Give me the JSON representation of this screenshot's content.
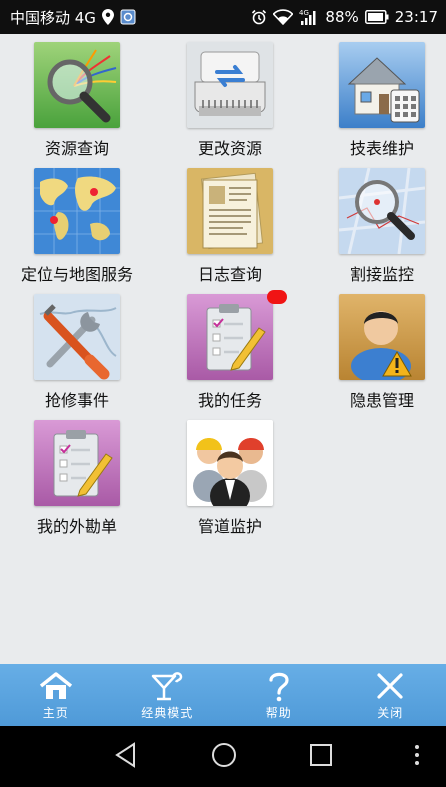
{
  "status_bar": {
    "carrier": "中国移动 4G",
    "battery": "88%",
    "time": "23:17"
  },
  "grid": {
    "tiles": [
      {
        "label": "资源查询",
        "icon": "resource-search-icon"
      },
      {
        "label": "更改资源",
        "icon": "change-resource-icon"
      },
      {
        "label": "技表维护",
        "icon": "meter-maintenance-icon"
      },
      {
        "label": "定位与地图服务",
        "icon": "map-location-icon"
      },
      {
        "label": "日志查询",
        "icon": "log-document-icon"
      },
      {
        "label": "割接监控",
        "icon": "map-magnifier-icon"
      },
      {
        "label": "抢修事件",
        "icon": "repair-tools-icon"
      },
      {
        "label": "我的任务",
        "icon": "task-clipboard-icon",
        "badge": true
      },
      {
        "label": "隐患管理",
        "icon": "hazard-user-icon"
      },
      {
        "label": "我的外勘单",
        "icon": "survey-clipboard-icon"
      },
      {
        "label": "管道监护",
        "icon": "workers-group-icon"
      }
    ]
  },
  "bottom_nav": {
    "items": [
      {
        "label": "主页",
        "icon": "home-icon"
      },
      {
        "label": "经典模式",
        "icon": "cocktail-icon"
      },
      {
        "label": "帮助",
        "icon": "question-icon"
      },
      {
        "label": "关闭",
        "icon": "close-icon"
      }
    ]
  },
  "colors": {
    "status_bar_bg": "#0f0f0f",
    "page_bg": "#e9ebed",
    "nav_bg": "#5aa2de",
    "badge": "#f01414"
  }
}
